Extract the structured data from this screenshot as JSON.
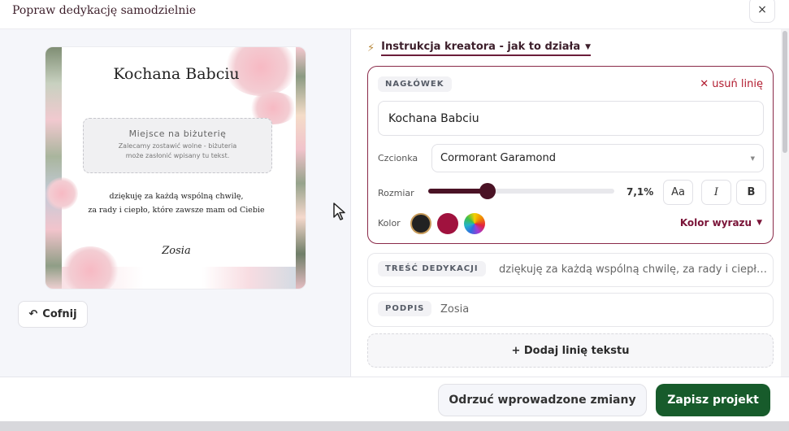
{
  "modal": {
    "title": "Popraw dedykację samodzielnie",
    "close_icon": "close-icon",
    "close_label": "×"
  },
  "preview": {
    "heading": "Kochana Babciu",
    "jewelry_title": "Miejsce na biżuterię",
    "jewelry_note_line1": "Zalecamy zostawić wolne - biżuteria",
    "jewelry_note_line2": "może zasłonić wpisany tu tekst.",
    "body_line1": "dziękuję za każdą wspólną chwilę,",
    "body_line2": "za rady i ciepło, które zawsze mam od Ciebie",
    "signature": "Zosia",
    "undo_icon": "undo-icon",
    "undo_label": "Cofnij"
  },
  "editor": {
    "guide_icon": "bolt-icon",
    "guide_label": "Instrukcja kreatora - jak to działa",
    "header_section": {
      "tag": "NAGŁÓWEK",
      "remove_label": "usuń linię",
      "text_value": "Kochana Babciu",
      "font_label": "Czcionka",
      "font_value": "Cormorant Garamond",
      "size_label": "Rozmiar",
      "size_value": "7,1%",
      "size_slider_fraction": 0.32,
      "case_button": "Aa",
      "italic_button": "I",
      "bold_button": "B",
      "color_label": "Kolor",
      "swatches": [
        "#222222",
        "#a0123e",
        "rainbow"
      ],
      "selected_swatch": "#222222",
      "word_color_label": "Kolor wyrazu"
    },
    "dedication_section": {
      "tag": "TREŚĆ DEDYKACJI",
      "text": "dziękuję za każdą wspólną chwilę, za rady i ciepło..."
    },
    "signature_section": {
      "tag": "PODPIS",
      "text": "Zosia"
    },
    "add_line_label": "+ Dodaj linię tekstu"
  },
  "footer": {
    "discard_label": "Odrzuć wprowadzone zmiany",
    "save_label": "Zapisz projekt"
  },
  "colors": {
    "accent_burgundy": "#8a2a49",
    "save_green": "#175b2b",
    "remove_red": "#b11a2e"
  }
}
